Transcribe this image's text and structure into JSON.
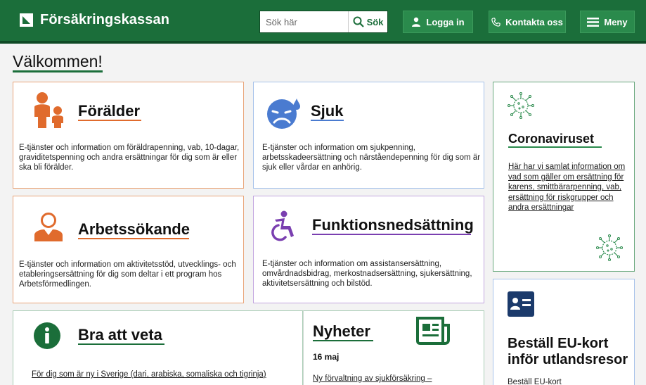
{
  "header": {
    "brand": "Försäkringskassan",
    "search_placeholder": "Sök här",
    "search_button": "Sök",
    "login": "Logga in",
    "contact": "Kontakta oss",
    "menu": "Meny"
  },
  "page": {
    "title": "Välkommen!"
  },
  "cards": {
    "foralder": {
      "title": "Förälder",
      "desc": "E-tjänster och information om föräldrapenning, vab, 10-dagar, graviditetspenning och andra ersättningar för dig som är eller ska bli förälder."
    },
    "sjuk": {
      "title": "Sjuk",
      "desc": "E-tjänster och information om sjukpenning, arbetsskadeersättning och närståendepenning för dig som är sjuk eller vårdar en anhörig."
    },
    "corona": {
      "title": "Coronaviruset",
      "desc": "Här har vi samlat information om vad som gäller om ersättning för karens, smittbärarpenning, vab, ersättning för riskgrupper och andra ersättningar"
    },
    "arbets": {
      "title": "Arbetssökande",
      "desc": "E-tjänster och information om aktivitetsstöd, utvecklings- och etableringsersättning för dig som deltar i ett program hos Arbetsförmedlingen."
    },
    "funktion": {
      "title": "Funktionsnedsättning",
      "desc": "E-tjänster och information om assistansersättning, omvårdnadsbidrag, merkostnadsersättning, sjukersättning, aktivitetsersättning och bilstöd."
    },
    "bra": {
      "title": "Bra att veta",
      "link": "För dig som är ny i Sverige (dari, arabiska, somaliska och tigrinja)"
    },
    "nyheter": {
      "title": "Nyheter",
      "date": "16 maj",
      "item": "Ny förvaltning av sjukförsäkring –"
    },
    "eukort": {
      "title_line1": "Beställ EU-kort",
      "title_line2": "inför utlandsresor",
      "desc": "Beställ EU-kort"
    }
  },
  "colors": {
    "brand_green": "#1b6e3a",
    "foralder_accent": "#e06b2d",
    "sjuk_accent": "#4a7bd0",
    "funktion_accent": "#7a3fb0",
    "corona_accent": "#2a8a4c"
  },
  "icons": [
    "search-icon",
    "user-icon",
    "phone-icon",
    "menu-icon",
    "parent-child-icon",
    "sick-face-icon",
    "virus-icon",
    "job-seeker-icon",
    "wheelchair-icon",
    "info-icon",
    "newspaper-icon",
    "id-card-icon"
  ]
}
